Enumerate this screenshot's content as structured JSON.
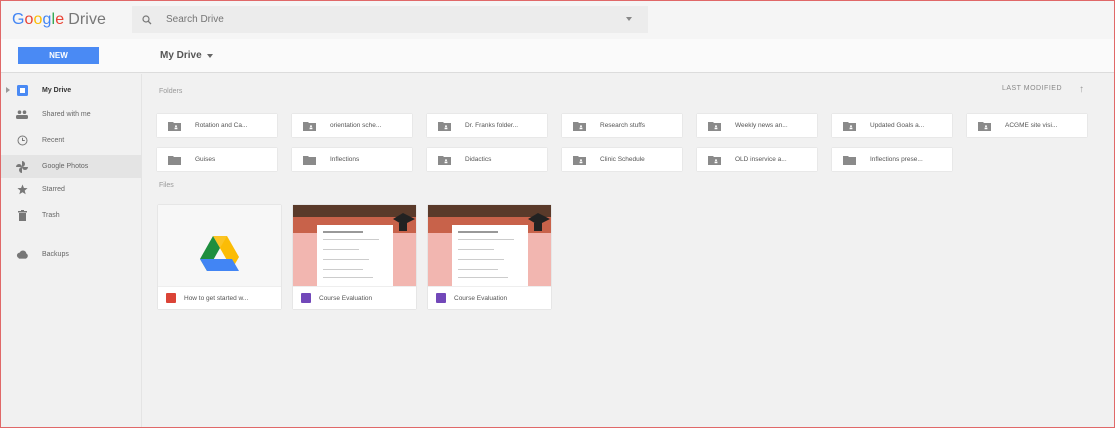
{
  "app": {
    "logo_google": "Google",
    "logo_drive": "Drive"
  },
  "search": {
    "placeholder": "Search Drive"
  },
  "toolbar": {
    "new_label": "NEW",
    "breadcrumb": "My Drive"
  },
  "sidebar": {
    "items": [
      {
        "label": "My Drive",
        "icon": "drive-icon"
      },
      {
        "label": "Shared with me",
        "icon": "people-icon"
      },
      {
        "label": "Recent",
        "icon": "clock-icon"
      },
      {
        "label": "Google Photos",
        "icon": "pinwheel-icon"
      },
      {
        "label": "Starred",
        "icon": "star-icon"
      },
      {
        "label": "Trash",
        "icon": "trash-icon"
      },
      {
        "label": "Backups",
        "icon": "cloud-icon"
      }
    ]
  },
  "main": {
    "folders_label": "Folders",
    "files_label": "Files",
    "sort_label": "LAST MODIFIED",
    "sort_arrow": "↑",
    "folders": [
      {
        "name": "Rotation and Ca...",
        "shared": true
      },
      {
        "name": "orientation sche...",
        "shared": true
      },
      {
        "name": "Dr. Franks folder...",
        "shared": true
      },
      {
        "name": "Research stuffs",
        "shared": true
      },
      {
        "name": "Weekly news an...",
        "shared": true
      },
      {
        "name": "Updated Goals a...",
        "shared": true
      },
      {
        "name": "ACGME site visi...",
        "shared": true
      },
      {
        "name": "Guises",
        "shared": false
      },
      {
        "name": "Inflections",
        "shared": false
      },
      {
        "name": "Didactics",
        "shared": true
      },
      {
        "name": "Clinic Schedule",
        "shared": true
      },
      {
        "name": "OLD inservice a...",
        "shared": true
      },
      {
        "name": "Inflections prese...",
        "shared": false
      }
    ],
    "files": [
      {
        "name": "How to get started w...",
        "type": "pdf",
        "color": "#db4437"
      },
      {
        "name": "Course Evaluation",
        "type": "form",
        "color": "#7248b9"
      },
      {
        "name": "Course Evaluation",
        "type": "form",
        "color": "#7248b9"
      }
    ]
  },
  "colors": {
    "accent": "#4a8af4",
    "frame": "#e06868"
  }
}
